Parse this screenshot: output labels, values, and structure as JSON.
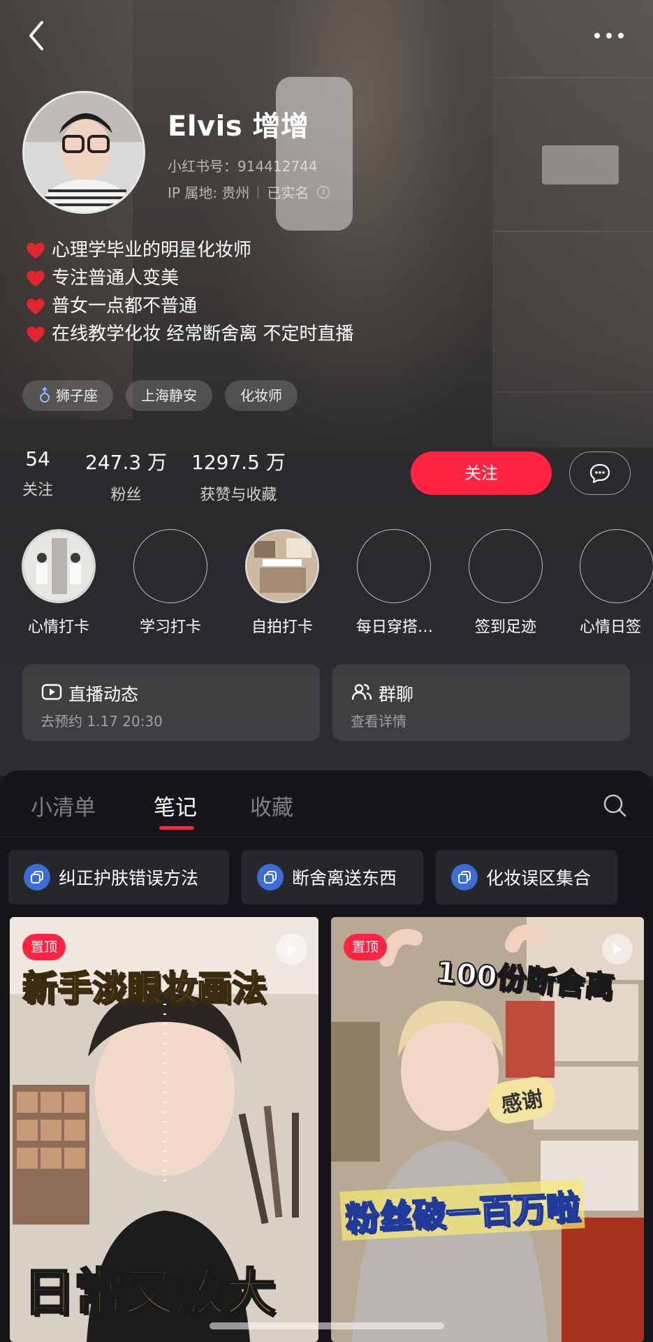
{
  "header": {
    "back_icon": "chevron-left-icon",
    "more_icon": "more-dots-icon"
  },
  "profile": {
    "nickname": "Elvis 增增",
    "red_id": "小红书号：914412744",
    "ip": "IP 属地: 贵州",
    "verified": "已实名",
    "info_icon": "info-circle-icon",
    "bio": [
      "心理学毕业的明星化妆师",
      "专注普通人变美",
      "普女一点都不普通",
      "在线教学化妆 经常断舍离 不定时直播"
    ],
    "tags": [
      "狮子座",
      "上海静安",
      "化妆师"
    ],
    "heart_color": "#e2242c"
  },
  "stats": {
    "following": {
      "num": "54",
      "label": "关注"
    },
    "fans": {
      "num": "247.3 万",
      "label": "粉丝"
    },
    "likes": {
      "num": "1297.5 万",
      "label": "获赞与收藏"
    }
  },
  "actions": {
    "follow": "关注",
    "message_icon": "chat-bubble-icon",
    "accent": "#ff2442"
  },
  "highlights": [
    "心情打卡",
    "学习打卡",
    "自拍打卡",
    "每日穿搭…",
    "签到足迹",
    "心情日签"
  ],
  "cards": {
    "live": {
      "title": "直播动态",
      "sub": "去预约 1.17 20:30",
      "icon": "live-video-icon"
    },
    "group": {
      "title": "群聊",
      "sub": "查看详情",
      "icon": "group-people-icon"
    }
  },
  "tabs": {
    "items": [
      "小清单",
      "笔记",
      "收藏"
    ],
    "active": "笔记",
    "search_icon": "search-icon"
  },
  "albums": [
    "纠正护肤错误方法",
    "断舍离送东西",
    "化妆误区集合"
  ],
  "notes": [
    {
      "pin": "置顶",
      "top_text": "新手淡眼妆画法",
      "bottom_text": "日常又放大"
    },
    {
      "pin": "置顶",
      "top_text": "100份断舍离",
      "mid_text": "感谢",
      "bottom_text": "粉丝破一百万啦"
    }
  ]
}
